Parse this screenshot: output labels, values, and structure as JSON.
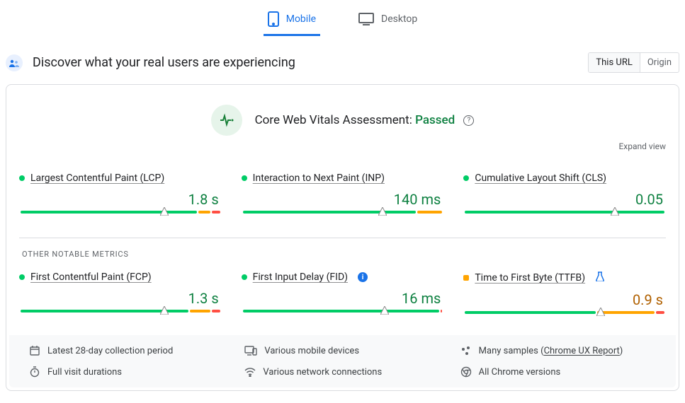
{
  "tabs": {
    "mobile": "Mobile",
    "desktop": "Desktop"
  },
  "header": {
    "title": "Discover what your real users are experiencing",
    "seg_this_url": "This URL",
    "seg_origin": "Origin"
  },
  "assessment": {
    "label": "Core Web Vitals Assessment:",
    "status": "Passed"
  },
  "expand": "Expand view",
  "other_label": "OTHER NOTABLE METRICS",
  "metrics": {
    "lcp": {
      "name": "Largest Contentful Paint (LCP)",
      "value": "1.8 s",
      "status": "g",
      "bar": [
        86,
        4,
        6,
        4
      ],
      "marker": 72
    },
    "inp": {
      "name": "Interaction to Next Paint (INP)",
      "value": "140 ms",
      "status": "g",
      "bar": [
        84,
        4,
        12,
        0
      ],
      "marker": 70
    },
    "cls": {
      "name": "Cumulative Layout Shift (CLS)",
      "value": "0.05",
      "status": "g",
      "bar": [
        100,
        0,
        0,
        0
      ],
      "marker": 75
    },
    "fcp": {
      "name": "First Contentful Paint (FCP)",
      "value": "1.3 s",
      "status": "g",
      "bar": [
        82,
        4,
        10,
        4
      ],
      "marker": 72
    },
    "fid": {
      "name": "First Input Delay (FID)",
      "value": "16 ms",
      "status": "g",
      "bar": [
        99,
        0,
        0,
        1
      ],
      "marker": 71
    },
    "ttfb": {
      "name": "Time to First Byte (TTFB)",
      "value": "0.9 s",
      "status": "o",
      "bar": [
        64,
        4,
        28,
        4
      ],
      "marker": 68
    }
  },
  "footer": {
    "period": "Latest 28-day collection period",
    "devices": "Various mobile devices",
    "samples_pre": "Many samples (",
    "samples_link": "Chrome UX Report",
    "samples_post": ")",
    "durations": "Full visit durations",
    "network": "Various network connections",
    "versions": "All Chrome versions"
  }
}
